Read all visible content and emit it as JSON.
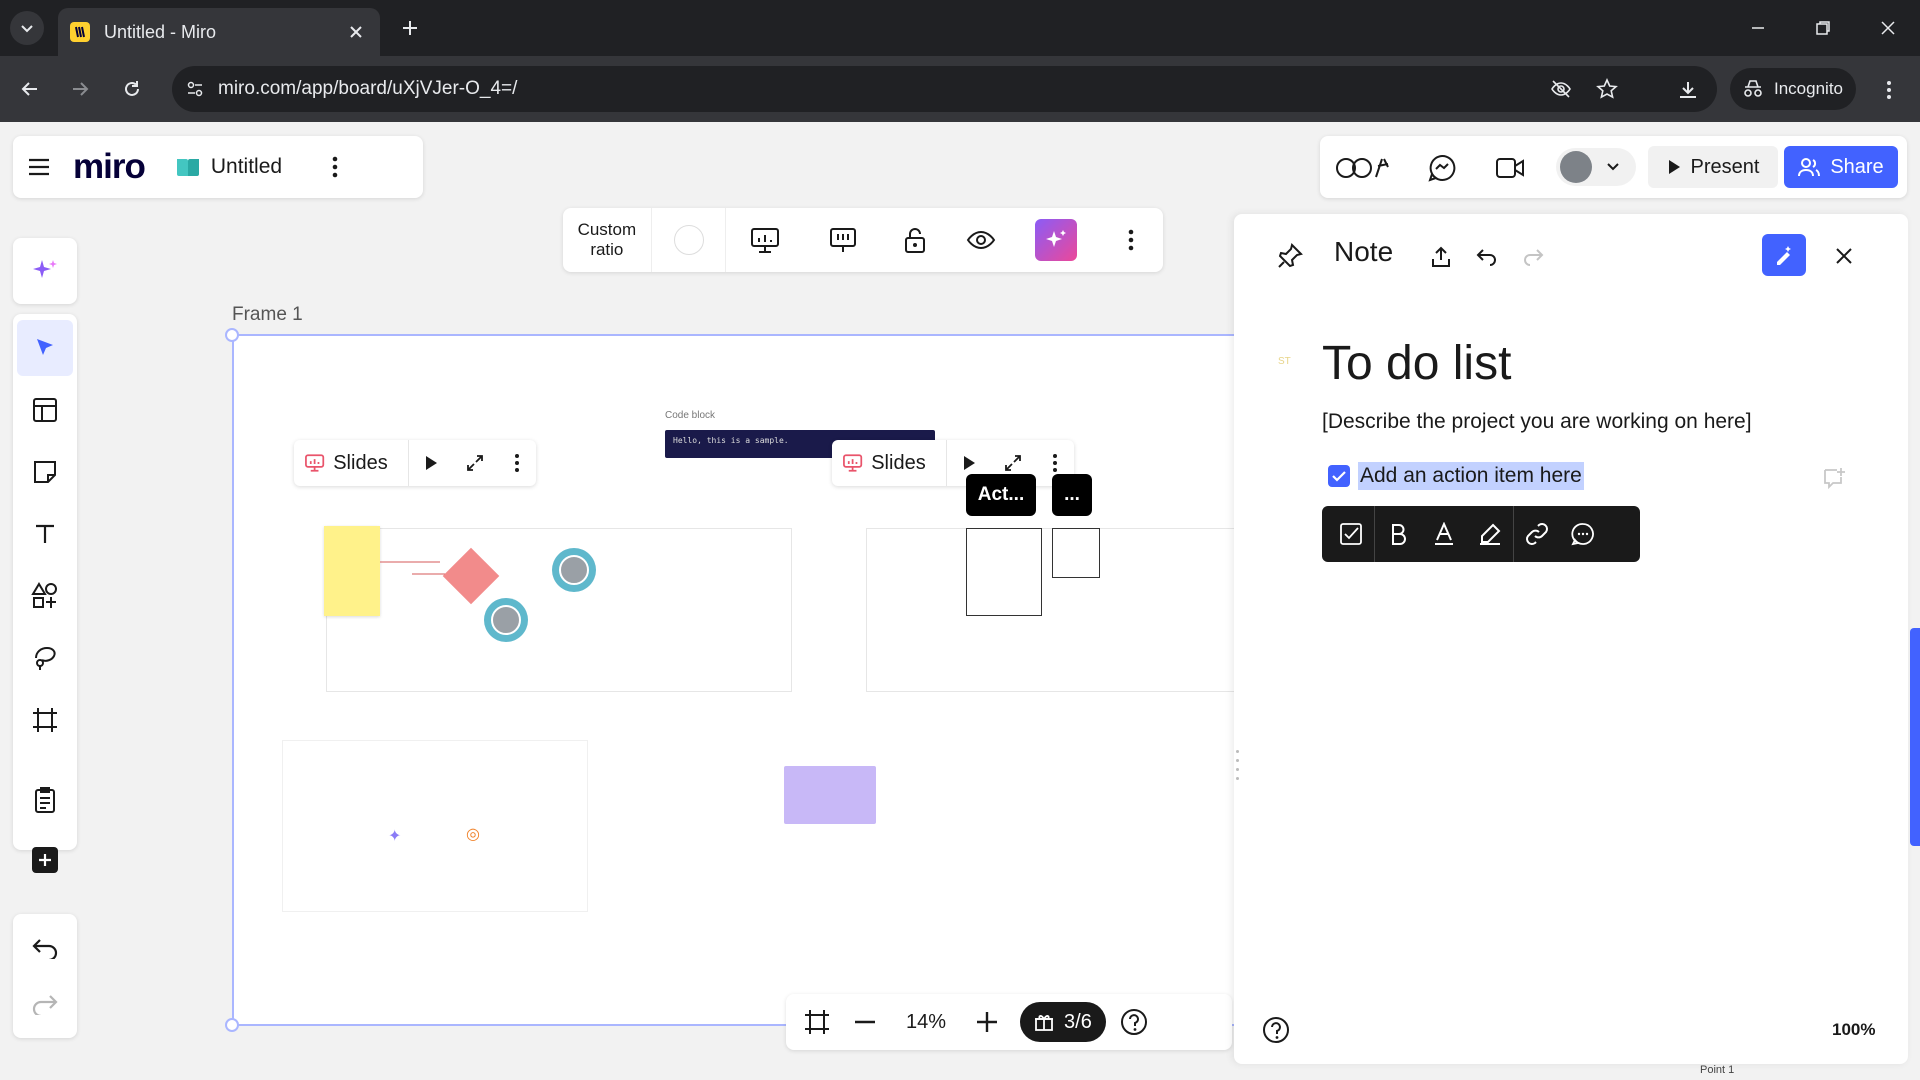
{
  "browser": {
    "tab_title": "Untitled - Miro",
    "url": "miro.com/app/board/uXjVJer-O_4=/",
    "incognito_label": "Incognito"
  },
  "miro": {
    "logo": "miro",
    "board_name": "Untitled",
    "present_label": "Present",
    "share_label": "Share",
    "brand_color": "#4262ff"
  },
  "frame_toolbar": {
    "ratio_label_line1": "Custom",
    "ratio_label_line2": "ratio"
  },
  "canvas": {
    "frame_label": "Frame 1",
    "slides_label_1": "Slides",
    "slides_label_2": "Slides",
    "code_block_label": "Code block",
    "code_block_text": "Hello, this is a sample.",
    "tag_act": "Act...",
    "tag_more": "..."
  },
  "bottom_bar": {
    "zoom": "14%",
    "page": "3/6"
  },
  "note_panel": {
    "title": "Note",
    "doc_title": "To do list",
    "description": "[Describe the project you are working on here]",
    "todo_item": "Add an action item here",
    "todo_checked": true,
    "zoom": "100%",
    "footer_hint": "Point 1"
  }
}
